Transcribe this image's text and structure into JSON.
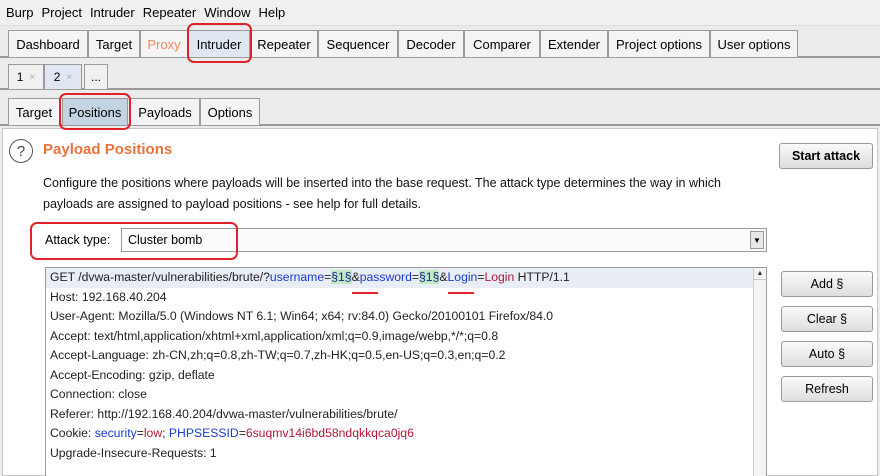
{
  "menu": [
    "Burp",
    "Project",
    "Intruder",
    "Repeater",
    "Window",
    "Help"
  ],
  "main_tabs": [
    "Dashboard",
    "Target",
    "Proxy",
    "Intruder",
    "Repeater",
    "Sequencer",
    "Decoder",
    "Comparer",
    "Extender",
    "Project options",
    "User options"
  ],
  "intruder_tabs": [
    {
      "label": "1",
      "close": "×"
    },
    {
      "label": "2",
      "close": "×"
    },
    {
      "label": "..."
    }
  ],
  "sub_tabs": [
    "Target",
    "Positions",
    "Payloads",
    "Options"
  ],
  "panel": {
    "help_glyph": "?",
    "title": "Payload Positions",
    "description": "Configure the positions where payloads will be inserted into the base request. The attack type determines the way in which payloads are assigned to payload positions - see help for full details.",
    "start_attack": "Start attack",
    "attack_type_label": "Attack type:",
    "attack_type_value": "Cluster bomb"
  },
  "request": {
    "line1": {
      "prefix": "GET /dvwa-master/vulnerabilities/brute/?",
      "param1": "username",
      "eq1": "=",
      "marker1": "§1§",
      "amp1": "&",
      "param2": "password",
      "eq2": "=",
      "marker2": "§1§",
      "amp2": "&",
      "param3": "Login",
      "eq3": "=",
      "val3": "Login",
      "suffix": " HTTP/1.1"
    },
    "headers": [
      "Host: 192.168.40.204",
      "User-Agent: Mozilla/5.0 (Windows NT 6.1; Win64; x64; rv:84.0) Gecko/20100101 Firefox/84.0",
      "Accept: text/html,application/xhtml+xml,application/xml;q=0.9,image/webp,*/*;q=0.8",
      "Accept-Language: zh-CN,zh;q=0.8,zh-TW;q=0.7,zh-HK;q=0.5,en-US;q=0.3,en;q=0.2",
      "Accept-Encoding: gzip, deflate",
      "Connection: close",
      "Referer: http://192.168.40.204/dvwa-master/vulnerabilities/brute/"
    ],
    "cookie": {
      "prefix": "Cookie: ",
      "name1": "security",
      "eq1": "=",
      "val1": "low",
      "sep": "; ",
      "name2": "PHPSESSID",
      "eq2": "=",
      "val2": "6suqmv14i6bd58ndqkkqca0jq6"
    },
    "last": "Upgrade-Insecure-Requests: 1"
  },
  "side_buttons": [
    "Add §",
    "Clear §",
    "Auto §",
    "Refresh"
  ],
  "colors": {
    "accent_title": "#e8733d",
    "proxy_tab": "#ef8a5a",
    "highlight": "#e0222a",
    "param_name": "#1a3ad0",
    "param_value": "#b0183a",
    "marker_bg": "#bfeac4"
  }
}
